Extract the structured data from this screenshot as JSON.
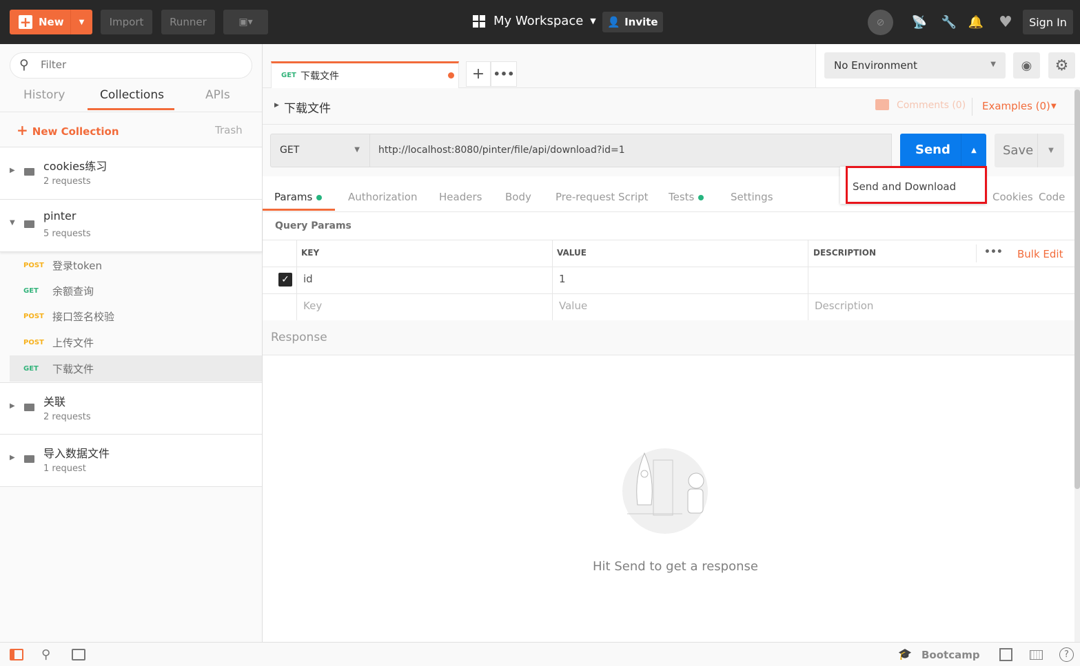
{
  "topbar": {
    "new_label": "New",
    "import_label": "Import",
    "runner_label": "Runner",
    "workspace": "My Workspace",
    "invite": "Invite",
    "sign_in": "Sign In"
  },
  "sidebar": {
    "filter_placeholder": "Filter",
    "tabs": [
      "History",
      "Collections",
      "APIs"
    ],
    "active_tab": "Collections",
    "new_collection": "New Collection",
    "trash": "Trash",
    "collections": [
      {
        "name": "cookies练习",
        "count": "2 requests",
        "expanded": false
      },
      {
        "name": "pinter",
        "count": "5 requests",
        "expanded": true,
        "requests": [
          {
            "method": "POST",
            "name": "登录token"
          },
          {
            "method": "GET",
            "name": "余额查询"
          },
          {
            "method": "POST",
            "name": "接口签名校验"
          },
          {
            "method": "POST",
            "name": "上传文件"
          },
          {
            "method": "GET",
            "name": "下载文件",
            "selected": true
          }
        ]
      },
      {
        "name": "关联",
        "count": "2 requests",
        "expanded": false
      },
      {
        "name": "导入数据文件",
        "count": "1 request",
        "expanded": false
      }
    ]
  },
  "tab": {
    "method": "GET",
    "name": "下载文件"
  },
  "environment": {
    "selected": "No Environment"
  },
  "request": {
    "name": "下载文件",
    "comments": "Comments (0)",
    "examples": "Examples (0)",
    "method": "GET",
    "url": "http://localhost:8080/pinter/file/api/download?id=1",
    "send": "Send",
    "save": "Save",
    "dropdown_item": "Send and Download",
    "tabs": [
      "Params",
      "Authorization",
      "Headers",
      "Body",
      "Pre-request Script",
      "Tests",
      "Settings"
    ],
    "cookies": "Cookies",
    "code": "Code"
  },
  "params": {
    "title": "Query Params",
    "headers": [
      "KEY",
      "VALUE",
      "DESCRIPTION"
    ],
    "bulk_edit": "Bulk Edit",
    "rows": [
      {
        "checked": true,
        "key": "id",
        "value": "1",
        "description": ""
      }
    ],
    "placeholders": {
      "key": "Key",
      "value": "Value",
      "description": "Description"
    }
  },
  "response": {
    "title": "Response",
    "empty": "Hit Send to get a response"
  },
  "statusbar": {
    "bootcamp": "Bootcamp"
  },
  "colors": {
    "brand": "#f26b3a",
    "send": "#097bed",
    "get": "#32b37a",
    "post": "#f7b11d",
    "highlight": "#e8141b"
  }
}
